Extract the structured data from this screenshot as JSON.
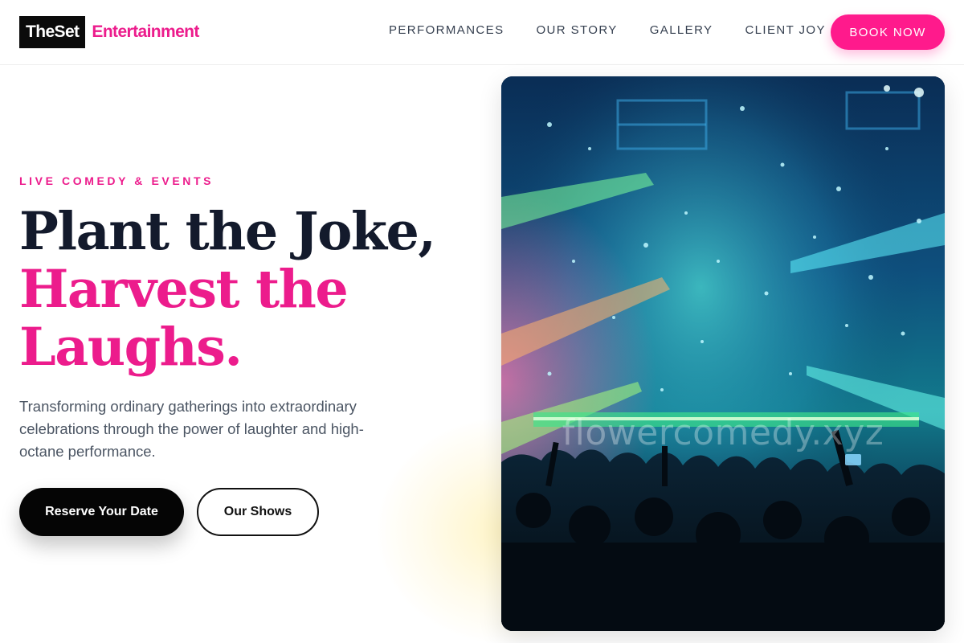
{
  "header": {
    "logo_box": "TheSet",
    "logo_suffix": "Entertainment",
    "nav": [
      "PERFORMANCES",
      "OUR STORY",
      "GALLERY",
      "CLIENT JOY"
    ],
    "cta": "BOOK NOW"
  },
  "hero": {
    "eyebrow": "LIVE COMEDY & EVENTS",
    "headline_line1": "Plant the Joke,",
    "headline_line2": "Harvest the",
    "headline_line3": "Laughs.",
    "description": "Transforming ordinary gatherings into extraordinary celebrations through the power of laughter and high-octane performance.",
    "primary_button": "Reserve Your Date",
    "secondary_button": "Our Shows",
    "image_watermark": "flowercomedy.xyz"
  },
  "colors": {
    "accent": "#ec1c8c",
    "cta": "#ff1a8c",
    "headline_dark": "#131a2c",
    "button_dark": "#050505"
  }
}
